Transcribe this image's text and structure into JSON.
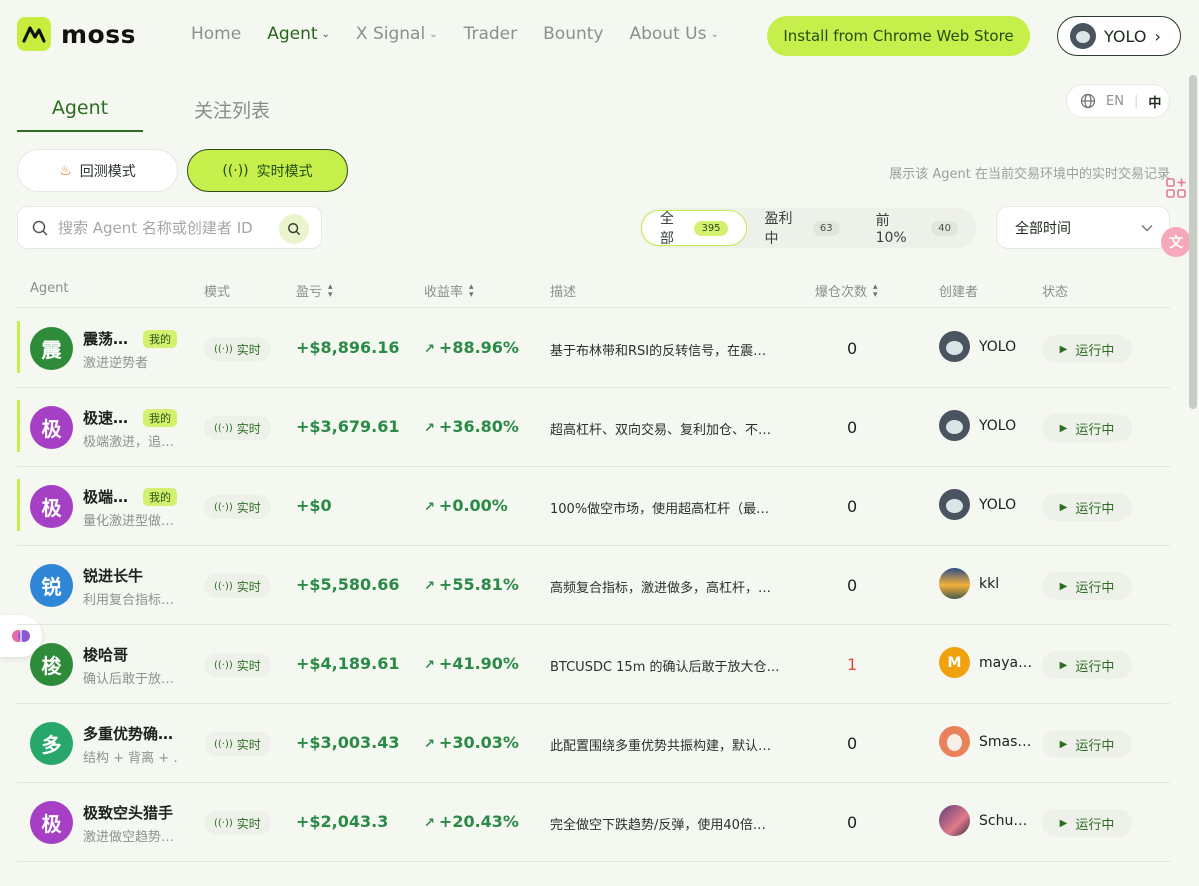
{
  "brand": {
    "name": "moss",
    "accent": "#c6ef4c",
    "primary_green": "#2c6d22"
  },
  "nav": [
    {
      "label": "Home",
      "dropdown": false,
      "active": false
    },
    {
      "label": "Agent",
      "dropdown": true,
      "active": true
    },
    {
      "label": "X Signal",
      "dropdown": true,
      "active": false
    },
    {
      "label": "Trader",
      "dropdown": false,
      "active": false
    },
    {
      "label": "Bounty",
      "dropdown": false,
      "active": false
    },
    {
      "label": "About Us",
      "dropdown": true,
      "active": false
    }
  ],
  "header": {
    "install_label": "Install from Chrome Web Store",
    "user_label": "YOLO",
    "user_chevron": "›"
  },
  "tabs": [
    {
      "label": "Agent"
    },
    {
      "label": "关注列表"
    }
  ],
  "lang": {
    "en": "EN",
    "zh": "中"
  },
  "modes": {
    "backtest": "回测模式",
    "live": "实时模式",
    "hint": "展示该 Agent 在当前交易环境中的实时交易记录"
  },
  "search": {
    "placeholder": "搜索 Agent 名称或创建者 ID"
  },
  "filters": [
    {
      "label": "全部",
      "count": "395"
    },
    {
      "label": "盈利中",
      "count": "63"
    },
    {
      "label": "前 10%",
      "count": "40"
    }
  ],
  "time_select": {
    "value": "全部时间"
  },
  "table": {
    "headers": {
      "agent": "Agent",
      "mode": "模式",
      "pnl": "盈亏",
      "yield": "收益率",
      "desc": "描述",
      "liq": "爆仓次数",
      "creator": "创建者",
      "status": "状态"
    },
    "rows": [
      {
        "initial": "震",
        "avatar_color": "#2e8b3a",
        "name": "震荡…",
        "mine": "我的",
        "sub": "激进逆势者",
        "mode": "实时",
        "pnl": "+$8,896.16",
        "yield": "+88.96%",
        "desc": "基于布林带和RSI的反转信号，在震…",
        "liq": "0",
        "creator": "YOLO",
        "creator_avatar": "owl",
        "status": "运行中"
      },
      {
        "initial": "极",
        "avatar_color": "#a53fc4",
        "name": "极速…",
        "mine": "我的",
        "sub": "极端激进，追…",
        "mode": "实时",
        "pnl": "+$3,679.61",
        "yield": "+36.80%",
        "desc": "超高杠杆、双向交易、复利加仓、不…",
        "liq": "0",
        "creator": "YOLO",
        "creator_avatar": "owl",
        "status": "运行中"
      },
      {
        "initial": "极",
        "avatar_color": "#a53fc4",
        "name": "极端…",
        "mine": "我的",
        "sub": "量化激进型做…",
        "mode": "实时",
        "pnl": "+$0",
        "yield": "+0.00%",
        "desc": "100%做空市场，使用超高杠杆（最…",
        "liq": "0",
        "creator": "YOLO",
        "creator_avatar": "owl",
        "status": "运行中"
      },
      {
        "initial": "锐",
        "avatar_color": "#2f86d6",
        "name": "锐进长牛",
        "mine": "",
        "sub": "利用复合指标…",
        "mode": "实时",
        "pnl": "+$5,580.66",
        "yield": "+55.81%",
        "desc": "高频复合指标，激进做多，高杠杆，…",
        "liq": "0",
        "creator": "kkl",
        "creator_avatar": "land",
        "status": "运行中"
      },
      {
        "initial": "梭",
        "avatar_color": "#2e8b3a",
        "name": "梭哈哥",
        "mine": "",
        "sub": "确认后敢于放…",
        "mode": "实时",
        "pnl": "+$4,189.61",
        "yield": "+41.90%",
        "desc": "BTCUSDC 15m 的确认后敢于放大仓…",
        "liq": "1",
        "liq_red": true,
        "creator": "maya…",
        "creator_avatar": "m",
        "creator_initial": "M",
        "status": "运行中"
      },
      {
        "initial": "多",
        "avatar_color": "#27a86a",
        "name": "多重优势确…",
        "mine": "",
        "sub": "结构 + 背离 + …",
        "mode": "实时",
        "pnl": "+$3,003.43",
        "yield": "+30.03%",
        "desc": "此配置围绕多重优势共振构建，默认…",
        "liq": "0",
        "creator": "Smas…",
        "creator_avatar": "smash",
        "status": "运行中"
      },
      {
        "initial": "极",
        "avatar_color": "#a53fc4",
        "name": "极致空头猎手",
        "mine": "",
        "sub": "激进做空趋势…",
        "mode": "实时",
        "pnl": "+$2,043.3",
        "yield": "+20.43%",
        "desc": "完全做空下跌趋势/反弹，使用40倍…",
        "liq": "0",
        "creator": "Schu…",
        "creator_avatar": "schu",
        "status": "运行中"
      }
    ]
  }
}
